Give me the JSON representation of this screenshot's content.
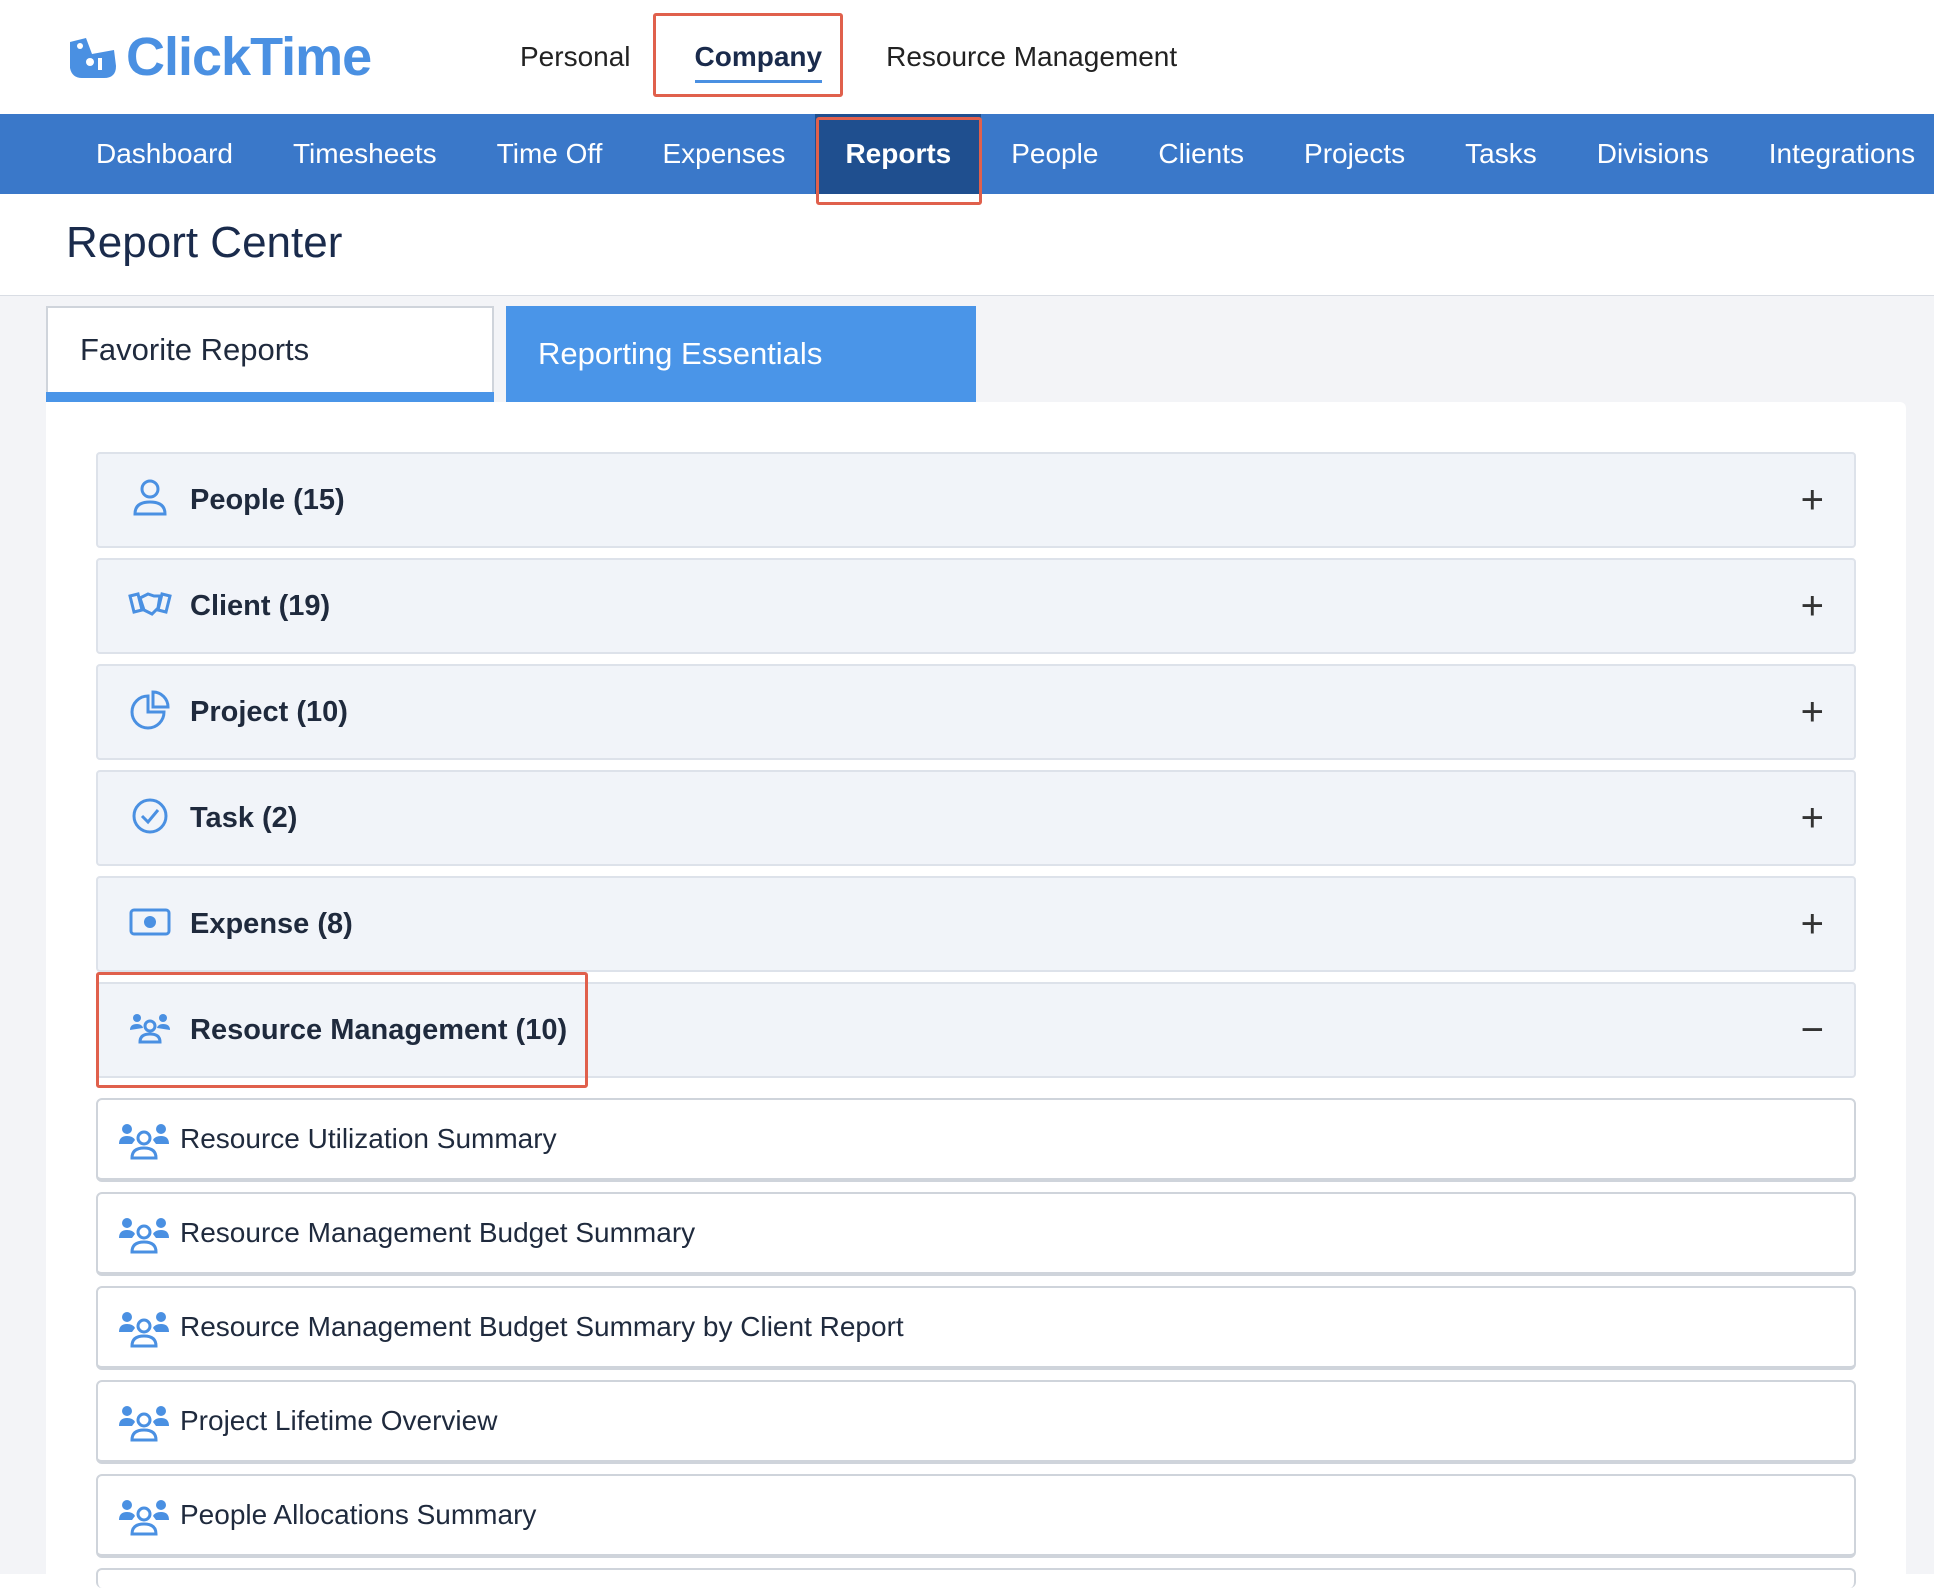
{
  "brand": {
    "name": "ClickTime",
    "color": "#4a90e2"
  },
  "top_nav": {
    "items": [
      {
        "label": "Personal",
        "active": false
      },
      {
        "label": "Company",
        "active": true
      },
      {
        "label": "Resource Management",
        "active": false
      }
    ]
  },
  "sub_nav": {
    "items": [
      {
        "label": "Dashboard"
      },
      {
        "label": "Timesheets"
      },
      {
        "label": "Time Off"
      },
      {
        "label": "Expenses"
      },
      {
        "label": "Reports",
        "active": true
      },
      {
        "label": "People"
      },
      {
        "label": "Clients"
      },
      {
        "label": "Projects"
      },
      {
        "label": "Tasks"
      },
      {
        "label": "Divisions"
      },
      {
        "label": "Integrations"
      }
    ]
  },
  "page": {
    "title": "Report Center"
  },
  "tabs": [
    {
      "label": "Favorite Reports",
      "active": false
    },
    {
      "label": "Reporting Essentials",
      "active": true
    }
  ],
  "categories": [
    {
      "label": "People (15)",
      "icon": "person-icon",
      "toggle": "+"
    },
    {
      "label": "Client (19)",
      "icon": "handshake-icon",
      "toggle": "+"
    },
    {
      "label": "Project (10)",
      "icon": "pie-chart-icon",
      "toggle": "+"
    },
    {
      "label": "Task (2)",
      "icon": "check-circle-icon",
      "toggle": "+"
    },
    {
      "label": "Expense (8)",
      "icon": "money-icon",
      "toggle": "+"
    },
    {
      "label": "Resource Management (10)",
      "icon": "team-icon",
      "toggle": "−",
      "expanded": true
    }
  ],
  "reports": [
    {
      "label": "Resource Utilization Summary"
    },
    {
      "label": "Resource Management Budget Summary"
    },
    {
      "label": "Resource Management Budget Summary by Client Report"
    },
    {
      "label": "Project Lifetime Overview"
    },
    {
      "label": "People Allocations Summary"
    }
  ],
  "colors": {
    "nav_bg": "#3a78c9",
    "nav_active": "#1f4f8f",
    "tab_active": "#4a95e8",
    "highlight": "#e0604c"
  }
}
